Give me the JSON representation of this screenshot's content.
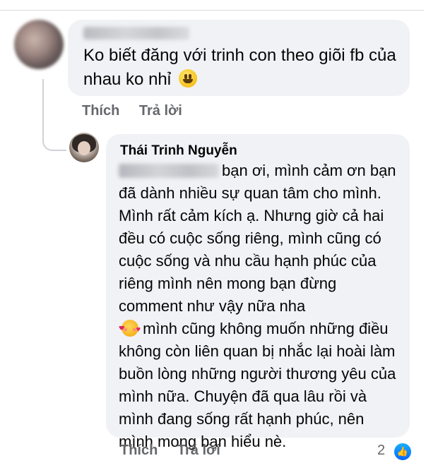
{
  "comment": {
    "author_name": "",
    "text": "Ko biết đăng với trinh con theo giõi fb của nhau ko nhỉ",
    "emoji_icon": "grinning-face-icon",
    "actions": {
      "like_label": "Thích",
      "reply_label": "Trả lời"
    }
  },
  "reply": {
    "author_name": "Thái Trinh Nguyễn",
    "text_part1": "bạn ơi, mình cảm ơn bạn đã dành nhiều sự quan tâm cho mình. Mình rất cảm kích ạ. Nhưng giờ cả hai đều có cuộc sống riêng, mình cũng có cuộc sống và nhu cầu hạnh phúc của riêng mình nên mong bạn đừng comment như vậy nữa nha",
    "emoji_icon": "smiling-face-with-hearts-icon",
    "text_part2": "mình cũng không muốn những điều không còn liên quan bị nhắc lại hoài làm buồn lòng những người thương yêu của mình nữa. Chuyện đã qua lâu rồi và mình đang sống rất hạnh phúc, nên mình mong bạn hiểu nè.",
    "actions": {
      "like_label": "Thích",
      "reply_label": "Trả lời"
    },
    "like_count": "2",
    "like_badge_icon": "thumbs-up-icon"
  },
  "colors": {
    "bubble": "#f0f2f5",
    "action_text": "#65676b",
    "like_blue": "#0866ff"
  }
}
